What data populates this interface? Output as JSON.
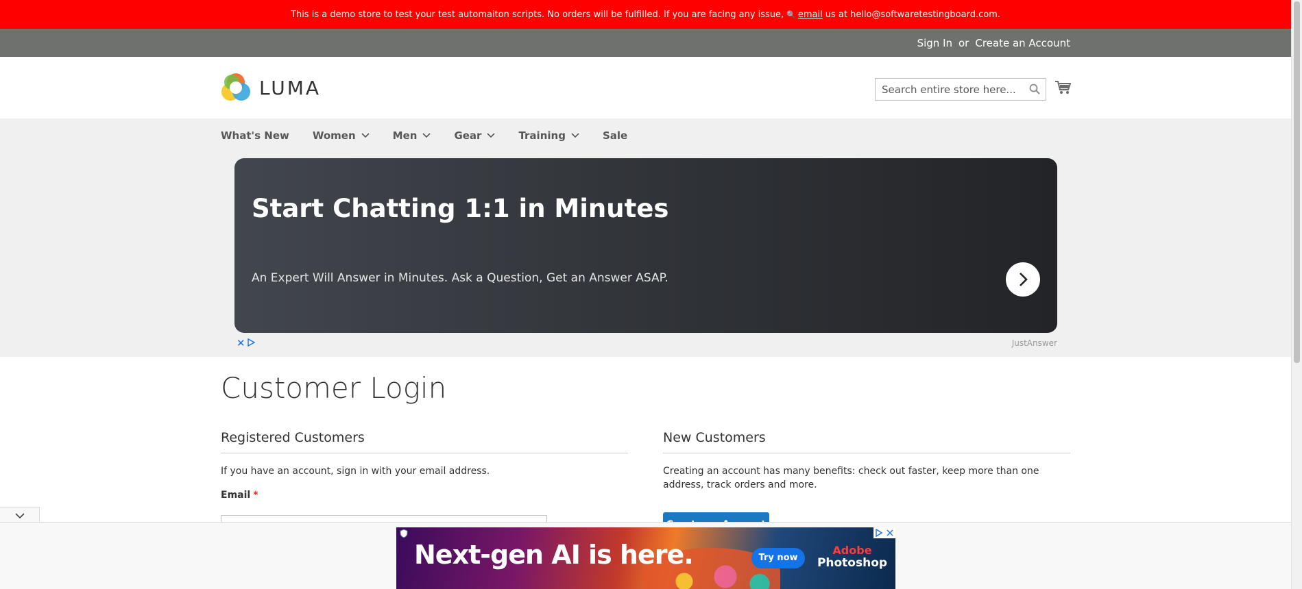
{
  "demo_notice": {
    "text": "This is a demo store to test your test automaiton scripts. No orders will be fulfilled. If you are facing any issue,",
    "email_link": "email",
    "suffix": "us at hello@softwaretestingboard.com.",
    "background": "#ff0000"
  },
  "panel": {
    "sign_in": "Sign In",
    "or": "or",
    "create_account": "Create an Account"
  },
  "header": {
    "logo_text": "LUMA",
    "search_placeholder": "Search entire store here...",
    "icons": [
      "search-icon",
      "cart-icon"
    ]
  },
  "nav": {
    "items": [
      {
        "label": "What's New",
        "has_dropdown": false
      },
      {
        "label": "Women",
        "has_dropdown": true
      },
      {
        "label": "Men",
        "has_dropdown": true
      },
      {
        "label": "Gear",
        "has_dropdown": true
      },
      {
        "label": "Training",
        "has_dropdown": true
      },
      {
        "label": "Sale",
        "has_dropdown": false
      }
    ]
  },
  "banner_ad": {
    "title": "Start Chatting 1:1 in Minutes",
    "subtitle": "An Expert Will Answer in Minutes. Ask a Question, Get an Answer ASAP.",
    "brand": "JustAnswer"
  },
  "main": {
    "page_title": "Customer Login",
    "registered": {
      "title": "Registered Customers",
      "text": "If you have an account, sign in with your email address.",
      "email_label": "Email",
      "required_mark": "*"
    },
    "new_customers": {
      "title": "New Customers",
      "text": "Creating an account has many benefits: check out faster, keep more than one address, track orders and more.",
      "button": "Create an Account"
    }
  },
  "anchor_ad": {
    "headline": "Next-gen AI is here.",
    "cta": "Try now",
    "brand_line1": "Adobe",
    "brand_line2": "Photoshop"
  },
  "colors": {
    "primary_button": "#1979c3",
    "panel": "#6e716e",
    "nav_bg": "#f0f0f0",
    "required": "#e02b27"
  }
}
